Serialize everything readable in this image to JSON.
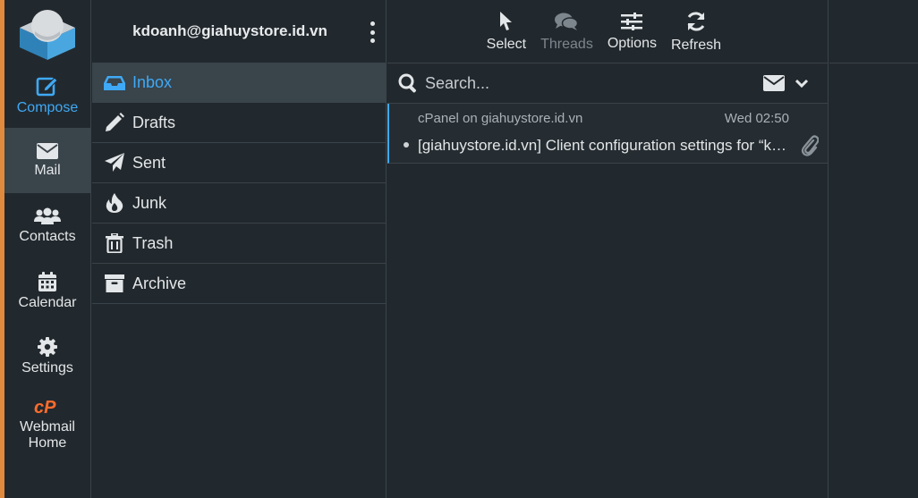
{
  "nav": {
    "compose": "Compose",
    "mail": "Mail",
    "contacts": "Contacts",
    "calendar": "Calendar",
    "settings": "Settings",
    "webmail_home": "Webmail Home",
    "webmail_home_line1": "Webmail",
    "webmail_home_line2": "Home"
  },
  "account": "kdoanh@giahuystore.id.vn",
  "folders": [
    {
      "label": "Inbox",
      "icon": "inbox-icon"
    },
    {
      "label": "Drafts",
      "icon": "pencil-icon"
    },
    {
      "label": "Sent",
      "icon": "paper-plane-icon"
    },
    {
      "label": "Junk",
      "icon": "fire-icon"
    },
    {
      "label": "Trash",
      "icon": "trash-icon"
    },
    {
      "label": "Archive",
      "icon": "archive-box-icon"
    }
  ],
  "toolbar": {
    "select": "Select",
    "threads": "Threads",
    "options": "Options",
    "refresh": "Refresh"
  },
  "search": {
    "placeholder": "Search..."
  },
  "messages": [
    {
      "from": "cPanel on giahuystore.id.vn",
      "date": "Wed 02:50",
      "subject": "[giahuystore.id.vn] Client configuration settings for “kdoanh@giahuystore.id.vn”.",
      "unread": true,
      "has_attachment": true
    }
  ],
  "colors": {
    "accent": "#3fa9f5",
    "background": "#22292e",
    "active": "#39444b",
    "cpanel_orange": "#ff6c2c",
    "edge": "#e08a3e"
  }
}
